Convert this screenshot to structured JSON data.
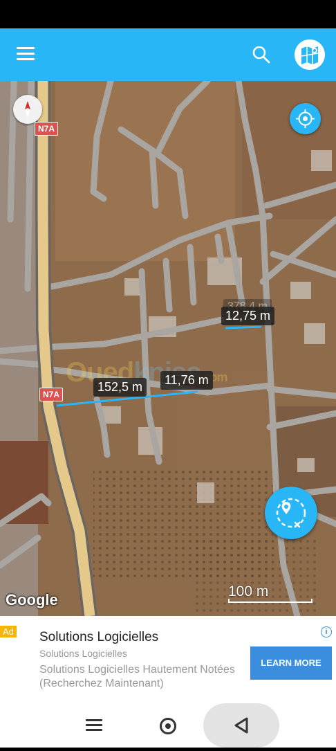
{
  "app": {
    "icons": {
      "menu": "hamburger-menu-icon",
      "search": "search-icon",
      "map_type": "map-type-icon"
    }
  },
  "map": {
    "road_labels": [
      "N7A",
      "N7A"
    ],
    "measurements": {
      "distance_total": "152,5 m",
      "segment_a": "11,76 m",
      "segment_b": "12,75 m",
      "faint_label": "378,4 m"
    },
    "watermark": {
      "part1": "Oued",
      "part2": "kniss",
      "suffix": ".com"
    },
    "attribution": "Google",
    "scale_label": "100 m",
    "colors": {
      "accent": "#29b6f6",
      "badge": "#d9534f",
      "measure_line": "#29b6f6"
    }
  },
  "ad": {
    "badge": "Ad",
    "title": "Solutions Logicielles",
    "subtitle": "Solutions Logicielles",
    "description": "Solutions Logicielles Hautement Notées (Recherchez Maintenant)",
    "cta": "LEARN MORE"
  }
}
